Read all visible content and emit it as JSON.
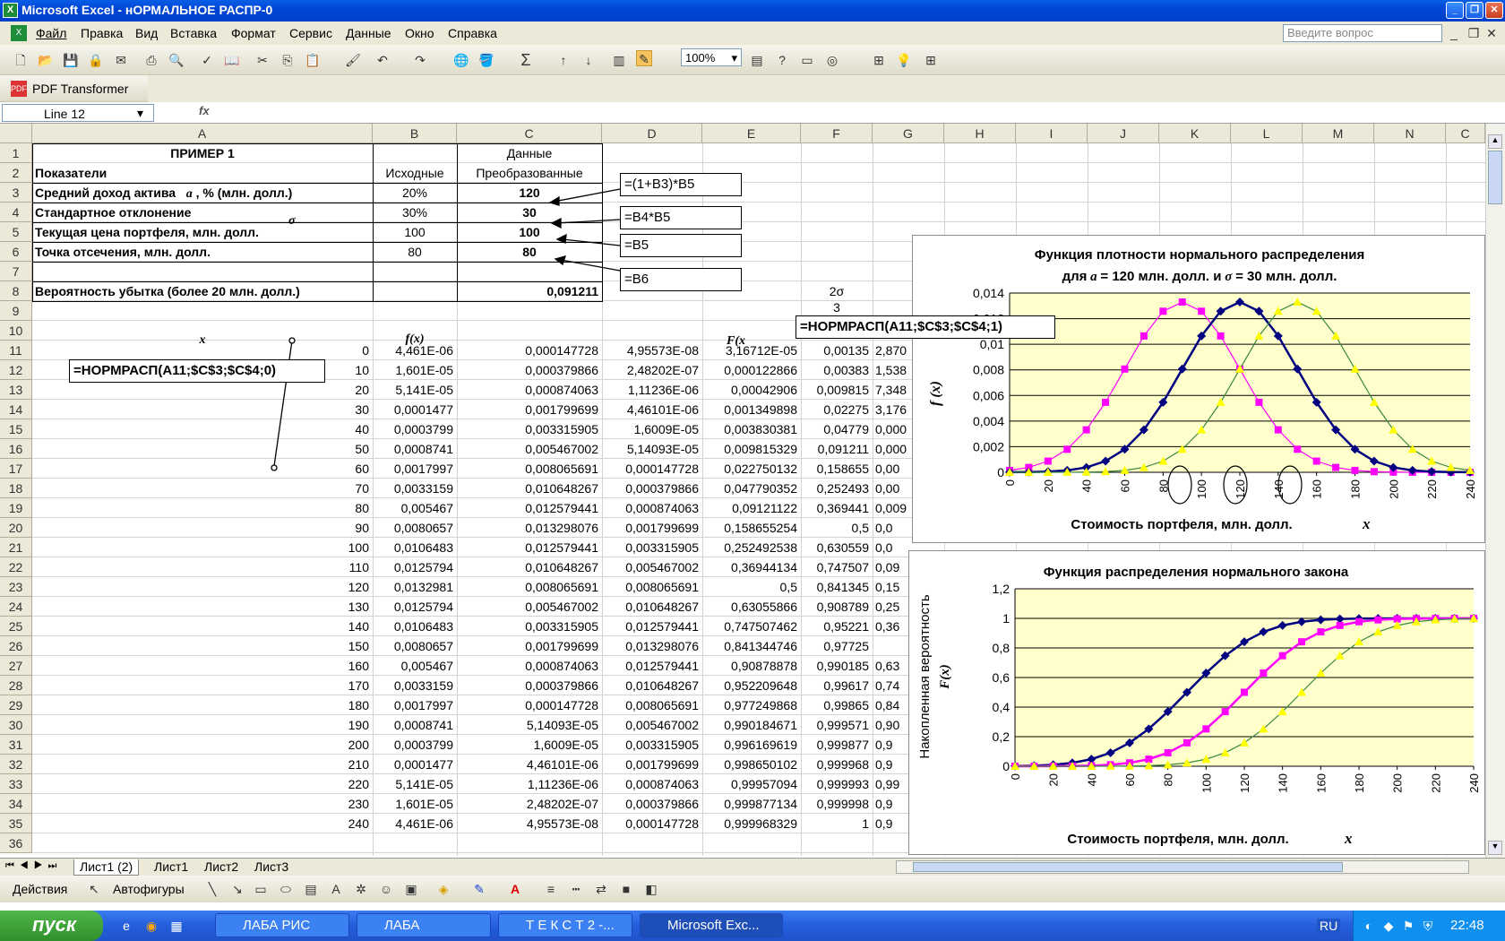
{
  "window": {
    "title": "Microsoft Excel - нОРМАЛЬНОЕ РАСПР-0"
  },
  "menu": {
    "items": [
      "Файл",
      "Правка",
      "Вид",
      "Вставка",
      "Формат",
      "Сервис",
      "Данные",
      "Окно",
      "Справка"
    ],
    "help_placeholder": "Введите вопрос"
  },
  "toolbar": {
    "zoom": "100%",
    "pdf_label": "PDF Transformer"
  },
  "formula_bar": {
    "name_box": "Line 12",
    "fx": "fx"
  },
  "columns": [
    "A",
    "B",
    "C",
    "D",
    "E",
    "F",
    "G",
    "H",
    "I",
    "J",
    "K",
    "L",
    "M",
    "N",
    "C"
  ],
  "rows": [
    "1",
    "2",
    "3",
    "4",
    "5",
    "6",
    "7",
    "8",
    "9",
    "10",
    "11",
    "12",
    "13",
    "14",
    "15",
    "16",
    "17",
    "18",
    "19",
    "20",
    "21",
    "22",
    "23",
    "24",
    "25",
    "26",
    "27",
    "28",
    "29",
    "30",
    "31",
    "32",
    "33",
    "34",
    "35",
    "36"
  ],
  "header": {
    "a1": "ПРИМЕР 1",
    "c1": "Данные",
    "a2": "Показатели",
    "b2": "Исходные",
    "c2": "Преобразованные",
    "a3": "Средний доход актива",
    "a3sym": "a",
    "a3rest": ", % (млн. долл.)",
    "b3": "20%",
    "c3": "120",
    "a4": "Стандартное отклонение",
    "a4sym": "σ",
    "b4": "30%",
    "c4": "30",
    "a5": "Текущая цена портфеля, млн. долл.",
    "b5": "100",
    "c5": "100",
    "a6": "Точка отсечения, млн. долл.",
    "b6": "80",
    "c6": "80",
    "a8": "Вероятность убытка (более 20 млн. долл.)",
    "c8": "0,091211",
    "a10": "x",
    "b10": "f(x)",
    "e10": "F(x",
    "f8": "2σ",
    "f9": "3"
  },
  "table": [
    [
      "0",
      "4,461E-06",
      "0,000147728",
      "4,95573E-08",
      "3,16712E-05",
      "0,00135",
      "2,870"
    ],
    [
      "10",
      "1,601E-05",
      "0,000379866",
      "2,48202E-07",
      "0,000122866",
      "0,00383",
      "1,538"
    ],
    [
      "20",
      "5,141E-05",
      "0,000874063",
      "1,11236E-06",
      "0,00042906",
      "0,009815",
      "7,348"
    ],
    [
      "30",
      "0,0001477",
      "0,001799699",
      "4,46101E-06",
      "0,001349898",
      "0,02275",
      "3,176"
    ],
    [
      "40",
      "0,0003799",
      "0,003315905",
      "1,6009E-05",
      "0,003830381",
      "0,04779",
      "0,000"
    ],
    [
      "50",
      "0,0008741",
      "0,005467002",
      "5,14093E-05",
      "0,009815329",
      "0,091211",
      "0,000"
    ],
    [
      "60",
      "0,0017997",
      "0,008065691",
      "0,000147728",
      "0,022750132",
      "0,158655",
      "0,00"
    ],
    [
      "70",
      "0,0033159",
      "0,010648267",
      "0,000379866",
      "0,047790352",
      "0,252493",
      "0,00"
    ],
    [
      "80",
      "0,005467",
      "0,012579441",
      "0,000874063",
      "0,09121122",
      "0,369441",
      "0,009"
    ],
    [
      "90",
      "0,0080657",
      "0,013298076",
      "0,001799699",
      "0,158655254",
      "0,5",
      "0,0"
    ],
    [
      "100",
      "0,0106483",
      "0,012579441",
      "0,003315905",
      "0,252492538",
      "0,630559",
      "0,0"
    ],
    [
      "110",
      "0,0125794",
      "0,010648267",
      "0,005467002",
      "0,36944134",
      "0,747507",
      "0,09"
    ],
    [
      "120",
      "0,0132981",
      "0,008065691",
      "0,008065691",
      "0,5",
      "0,841345",
      "0,15"
    ],
    [
      "130",
      "0,0125794",
      "0,005467002",
      "0,010648267",
      "0,63055866",
      "0,908789",
      "0,25"
    ],
    [
      "140",
      "0,0106483",
      "0,003315905",
      "0,012579441",
      "0,747507462",
      "0,95221",
      "0,36"
    ],
    [
      "150",
      "0,0080657",
      "0,001799699",
      "0,013298076",
      "0,841344746",
      "0,97725",
      ""
    ],
    [
      "160",
      "0,005467",
      "0,000874063",
      "0,012579441",
      "0,90878878",
      "0,990185",
      "0,63"
    ],
    [
      "170",
      "0,0033159",
      "0,000379866",
      "0,010648267",
      "0,952209648",
      "0,99617",
      "0,74"
    ],
    [
      "180",
      "0,0017997",
      "0,000147728",
      "0,008065691",
      "0,977249868",
      "0,99865",
      "0,84"
    ],
    [
      "190",
      "0,0008741",
      "5,14093E-05",
      "0,005467002",
      "0,990184671",
      "0,999571",
      "0,90"
    ],
    [
      "200",
      "0,0003799",
      "1,6009E-05",
      "0,003315905",
      "0,996169619",
      "0,999877",
      "0,9"
    ],
    [
      "210",
      "0,0001477",
      "4,46101E-06",
      "0,001799699",
      "0,998650102",
      "0,999968",
      "0,9"
    ],
    [
      "220",
      "5,141E-05",
      "1,11236E-06",
      "0,000874063",
      "0,99957094",
      "0,999993",
      "0,99"
    ],
    [
      "230",
      "1,601E-05",
      "2,48202E-07",
      "0,000379866",
      "0,999877134",
      "0,999998",
      "0,9"
    ],
    [
      "240",
      "4,461E-06",
      "4,95573E-08",
      "0,000147728",
      "0,999968329",
      "1",
      "0,9"
    ]
  ],
  "callouts": {
    "c3": "=(1+B3)*B5",
    "c4": "=B4*B5",
    "c5": "=B5",
    "c6": "=B6",
    "norm_pdf": "=НОРМРАСП(A11;$C$3;$C$4;0)",
    "norm_cdf": "=НОРМРАСП(A11;$C$3;$C$4;1)"
  },
  "chart_data": [
    {
      "type": "line",
      "title": "Функция плотности нормального распределения",
      "subtitle_pre": "для",
      "subtitle_a": "a",
      "subtitle_mid": "= 120 млн. долл. и",
      "subtitle_s": "σ",
      "subtitle_post": "= 30 млн. долл.",
      "xlabel": "Стоимость портфеля, млн. долл.",
      "xsym": "x",
      "ylabel": "f (x)",
      "x": [
        0,
        10,
        20,
        30,
        40,
        50,
        60,
        70,
        80,
        90,
        100,
        110,
        120,
        130,
        140,
        150,
        160,
        170,
        180,
        190,
        200,
        210,
        220,
        230,
        240
      ],
      "xticks": [
        "0",
        "20",
        "40",
        "60",
        "80",
        "100",
        "120",
        "140",
        "160",
        "180",
        "200",
        "220",
        "240"
      ],
      "yticks": [
        "0",
        "0,002",
        "0,004",
        "0,006",
        "0,008",
        "0,01",
        "0,012",
        "0,014"
      ],
      "ylim": [
        0,
        0.014
      ],
      "series": [
        {
          "color": "#ff00ff",
          "values": [
            0.000147728,
            0.000379866,
            0.000874063,
            0.001799699,
            0.003315905,
            0.005467002,
            0.008065691,
            0.010648267,
            0.012579441,
            0.013298076,
            0.012579441,
            0.010648267,
            0.008065691,
            0.005467002,
            0.003315905,
            0.001799699,
            0.000874063,
            0.000379866,
            0.000147728,
            5.14e-05,
            1.6e-05,
            4.5e-06,
            1.1e-06,
            2.5e-07,
            5e-08
          ]
        },
        {
          "color": "#000080",
          "values": [
            4.5e-06,
            1.6e-05,
            5.14e-05,
            0.0001477,
            0.0003799,
            0.0008741,
            0.0017997,
            0.0033159,
            0.005467,
            0.0080657,
            0.0106483,
            0.0125794,
            0.0132981,
            0.0125794,
            0.0106483,
            0.0080657,
            0.005467,
            0.0033159,
            0.0017997,
            0.0008741,
            0.0003799,
            0.0001477,
            5.14e-05,
            1.6e-05,
            4.5e-06
          ]
        },
        {
          "color": "#ffff00",
          "values": [
            5e-08,
            2.5e-07,
            1.1e-06,
            4.5e-06,
            1.6e-05,
            5.14e-05,
            0.000147728,
            0.000379866,
            0.000874063,
            0.001799699,
            0.003315905,
            0.005467002,
            0.008065691,
            0.010648267,
            0.012579441,
            0.013298076,
            0.012579441,
            0.010648267,
            0.008065691,
            0.005467002,
            0.003315905,
            0.001799699,
            0.000874063,
            0.000379866,
            0.000147728
          ]
        }
      ]
    },
    {
      "type": "line",
      "title": "Функция распределения нормального закона",
      "xlabel": "Стоимость портфеля, млн. долл.",
      "xsym": "x",
      "ylabel": "Накопленная вероятность",
      "ylabel2": "F(x)",
      "x": [
        0,
        10,
        20,
        30,
        40,
        50,
        60,
        70,
        80,
        90,
        100,
        110,
        120,
        130,
        140,
        150,
        160,
        170,
        180,
        190,
        200,
        210,
        220,
        230,
        240
      ],
      "xticks": [
        "0",
        "20",
        "40",
        "60",
        "80",
        "100",
        "120",
        "140",
        "160",
        "180",
        "200",
        "220",
        "240"
      ],
      "yticks": [
        "0",
        "0,2",
        "0,4",
        "0,6",
        "0,8",
        "1",
        "1,2"
      ],
      "ylim": [
        0,
        1.2
      ],
      "series": [
        {
          "color": "#000080",
          "values": [
            0.00135,
            0.00383,
            0.009815,
            0.02275,
            0.04779,
            0.091211,
            0.158655,
            0.252493,
            0.369441,
            0.5,
            0.630559,
            0.747507,
            0.841345,
            0.908789,
            0.95221,
            0.97725,
            0.990185,
            0.99617,
            0.99865,
            0.999571,
            0.999877,
            0.999968,
            0.999993,
            0.999998,
            1
          ]
        },
        {
          "color": "#ff00ff",
          "values": [
            3.17e-05,
            0.000123,
            0.000429,
            0.00135,
            0.00383,
            0.009815,
            0.02275,
            0.04779,
            0.091211,
            0.158655,
            0.252493,
            0.369441,
            0.5,
            0.630559,
            0.747507,
            0.841345,
            0.908789,
            0.95221,
            0.97725,
            0.990185,
            0.99617,
            0.99865,
            0.999571,
            0.999877,
            0.999968
          ]
        },
        {
          "color": "#ffff00",
          "values": [
            4e-07,
            2.4e-06,
            1.15e-05,
            4e-05,
            0.000135,
            0.000383,
            0.00135,
            0.00383,
            0.009815,
            0.02275,
            0.04779,
            0.091211,
            0.158655,
            0.252493,
            0.369441,
            0.5,
            0.630559,
            0.747507,
            0.841345,
            0.908789,
            0.95221,
            0.97725,
            0.990185,
            0.99617,
            0.99865
          ]
        }
      ]
    }
  ],
  "sheets": [
    "Лист1 (2)",
    "Лист1",
    "Лист2",
    "Лист3"
  ],
  "drawing": {
    "actions": "Действия",
    "autoshapes": "Автофигуры"
  },
  "taskbar": {
    "start": "пуск",
    "tasks": [
      "ЛАБА РИС",
      "ЛАБА",
      "Т Е К С Т 2 -...",
      "Microsoft Exc..."
    ],
    "lang": "RU",
    "clock": "22:48"
  }
}
